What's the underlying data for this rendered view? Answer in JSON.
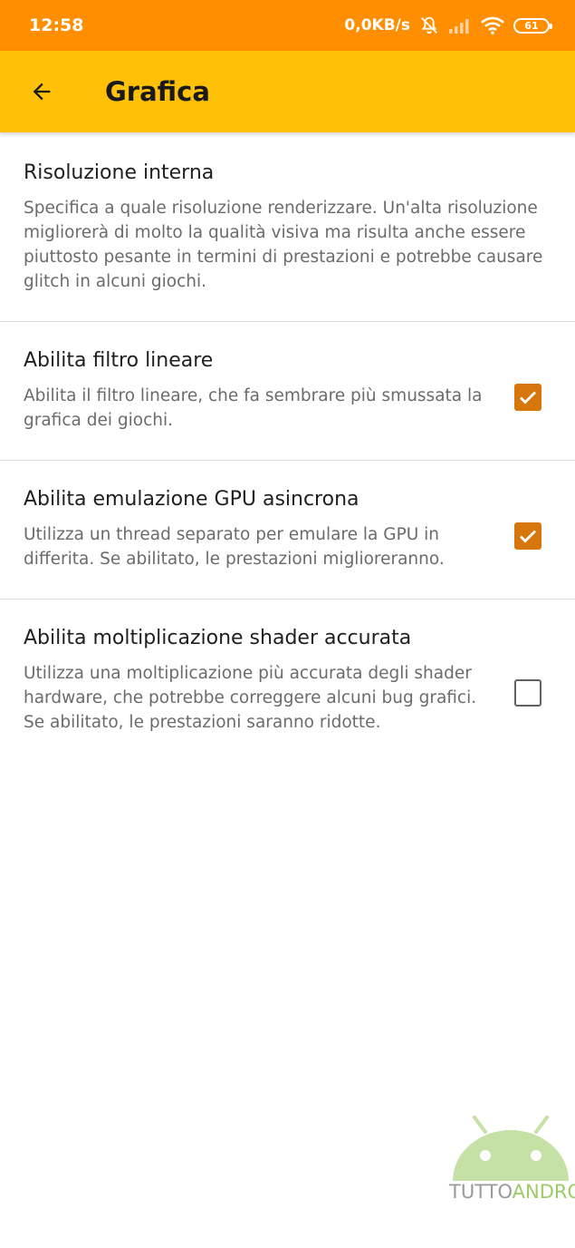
{
  "status_bar": {
    "time": "12:58",
    "net_speed": "0,0KB/s",
    "battery_level": "61"
  },
  "app_bar": {
    "title": "Grafica",
    "back_icon": "arrow-back-icon"
  },
  "colors": {
    "status_bar": "#ff8f00",
    "app_bar": "#ffc107",
    "checkbox_checked": "#d6760d"
  },
  "settings": [
    {
      "title": "Risoluzione interna",
      "description": "Specifica a quale risoluzione renderizzare. Un'alta risoluzione migliorerà di molto la qualità visiva ma risulta anche essere piuttosto pesante in termini di prestazioni e potrebbe causare glitch in alcuni giochi.",
      "has_checkbox": false
    },
    {
      "title": "Abilita filtro lineare",
      "description": "Abilita il filtro lineare, che fa sembrare più smussata la grafica dei giochi.",
      "has_checkbox": true,
      "checked": true
    },
    {
      "title": "Abilita emulazione GPU asincrona",
      "description": "Utilizza un thread separato per emulare la GPU in differita. Se abilitato, le prestazioni miglioreranno.",
      "has_checkbox": true,
      "checked": true
    },
    {
      "title": "Abilita moltiplicazione shader accurata",
      "description": "Utilizza una moltiplicazione più accurata degli shader hardware, che potrebbe correggere alcuni bug grafici. Se abilitato, le prestazioni saranno ridotte.",
      "has_checkbox": true,
      "checked": false
    }
  ],
  "watermark": {
    "part1": "TUTTO",
    "part2": "ANDROID"
  }
}
